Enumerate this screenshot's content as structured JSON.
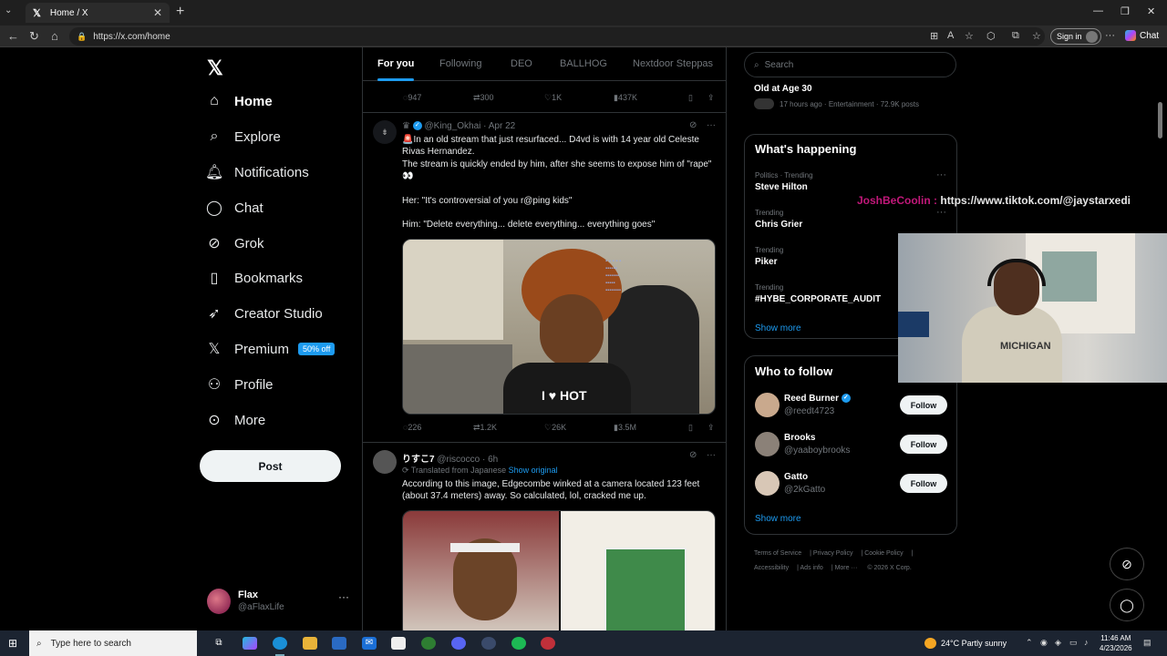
{
  "browser": {
    "tab_title": "Home / X",
    "url": "https://x.com/home",
    "signin_label": "Sign in",
    "chat_label": "Chat"
  },
  "nav": {
    "items": [
      {
        "label": "Home",
        "icon": "home-icon"
      },
      {
        "label": "Explore",
        "icon": "search-icon"
      },
      {
        "label": "Notifications",
        "icon": "bell-icon"
      },
      {
        "label": "Chat",
        "icon": "chat-bubble-icon"
      },
      {
        "label": "Grok",
        "icon": "grok-icon"
      },
      {
        "label": "Bookmarks",
        "icon": "bookmark-icon"
      },
      {
        "label": "Creator Studio",
        "icon": "rocket-icon"
      },
      {
        "label": "Premium",
        "icon": "x-logo-icon"
      },
      {
        "label": "Profile",
        "icon": "person-icon"
      },
      {
        "label": "More",
        "icon": "more-circle-icon"
      }
    ],
    "premium_badge": "50% off",
    "post_label": "Post",
    "user": {
      "name": "Flax",
      "handle": "@aFlaxLife"
    }
  },
  "timeline": {
    "tabs": [
      "For you",
      "Following",
      "DEO",
      "BALLHOG",
      "Nextdoor Steppas"
    ],
    "prev_actions": {
      "replies": "947",
      "reposts": "300",
      "likes": "1K",
      "views": "437K"
    },
    "tweets": [
      {
        "handle": "@King_Okhai",
        "time": "Apr 22",
        "lines": [
          "🚨In an old stream that just resurfaced... D4vd is with 14 year old Celeste Rivas Hernandez.",
          "The stream is quickly ended by him, after she seems to expose him of \"rape\" 👀",
          "",
          "Her: \"It's controversial of you r@ping kids\"",
          "",
          "Him: \"Delete everything... delete everything... everything goes\""
        ],
        "video_shirt_text": "I ♥ HOT",
        "actions": {
          "replies": "226",
          "reposts": "1.2K",
          "likes": "26K",
          "views": "3.5M"
        }
      },
      {
        "name": "りすこ7",
        "handle": "@riscocco",
        "time": "6h",
        "translated": "Translated from Japanese",
        "show_original": "Show original",
        "text": "According to this image, Edgecombe winked at a camera located 123 feet (about 37.4 meters) away. So calculated, lol, cracked me up."
      }
    ]
  },
  "sidebar": {
    "search_placeholder": "Search",
    "top_trend": {
      "title": "Old at Age 30",
      "meta": "17 hours ago · Entertainment · 72.9K posts"
    },
    "happening_title": "What's happening",
    "trends": [
      {
        "label": "Politics · Trending",
        "name": "Steve Hilton"
      },
      {
        "label": "Trending",
        "name": "Chris Grier"
      },
      {
        "label": "Trending",
        "name": "Piker"
      },
      {
        "label": "Trending",
        "name": "#HYBE_CORPORATE_AUDIT"
      }
    ],
    "show_more": "Show more",
    "wtf_title": "Who to follow",
    "follow": [
      {
        "name": "Reed Burner",
        "handle": "@reedt4723",
        "verified": true
      },
      {
        "name": "Brooks",
        "handle": "@yaaboybrooks",
        "verified": false
      },
      {
        "name": "Gatto",
        "handle": "@2kGatto",
        "verified": false
      }
    ],
    "follow_label": "Follow",
    "footer": [
      "Terms of Service",
      "Privacy Policy",
      "Cookie Policy",
      "Accessibility",
      "Ads info",
      "More ···",
      "© 2026 X Corp."
    ]
  },
  "overlay": {
    "user": "JoshBeCoolin :",
    "url": "https://www.tiktok.com/@jaystarxedi",
    "shirt_text": "MICHIGAN"
  },
  "taskbar": {
    "search_placeholder": "Type here to search",
    "weather": "24°C  Partly sunny",
    "time": "11:46 AM",
    "date": "4/23/2026"
  }
}
